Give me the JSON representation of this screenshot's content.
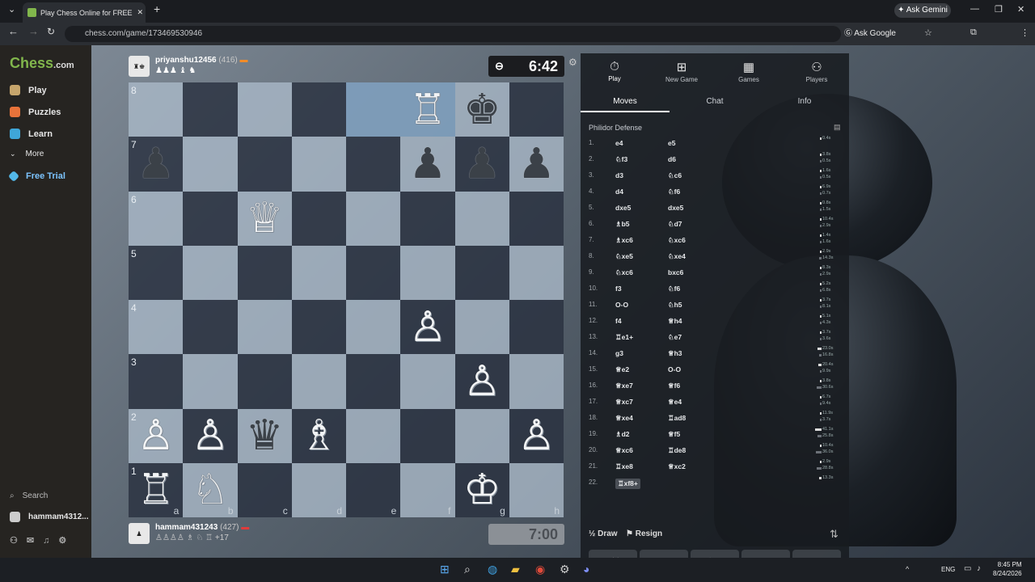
{
  "browser": {
    "tab_title": "Play Chess Online for FREE",
    "url": "chess.com/game/173469530946",
    "ask_google": "Ask Google",
    "ask_gemini": "Ask Gemini"
  },
  "sidebar": {
    "logo_main": "Chess",
    "logo_suffix": ".com",
    "items": [
      {
        "label": "Play",
        "icon": "pawn-icon"
      },
      {
        "label": "Puzzles",
        "icon": "puzzle-icon"
      },
      {
        "label": "Learn",
        "icon": "graduation-cap-icon"
      },
      {
        "label": "More",
        "icon": "chevron-down-icon"
      },
      {
        "label": "Free Trial",
        "icon": "diamond-icon"
      }
    ],
    "search_label": "Search",
    "user_label": "hammam4312..."
  },
  "top_player": {
    "name": "priyanshu12456",
    "rating": "(416)",
    "captured": "♟♟♟ ♝ ♞",
    "clock": "6:42"
  },
  "bottom_player": {
    "name": "hammam431243",
    "rating": "(427)",
    "captured": "♙♙♙♙ ♗ ♘ ♖",
    "advantage": "+17",
    "clock": "7:00"
  },
  "board": {
    "ranks": [
      "8",
      "7",
      "6",
      "5",
      "4",
      "3",
      "2",
      "1"
    ],
    "files": [
      "a",
      "b",
      "c",
      "d",
      "e",
      "f",
      "g",
      "h"
    ],
    "squares": [
      [
        "",
        "",
        "",
        "",
        "",
        "♖",
        "♚",
        ""
      ],
      [
        "♟",
        "",
        "",
        "",
        "",
        "♟",
        "♟",
        "♟"
      ],
      [
        "",
        "",
        "♕",
        "",
        "",
        "",
        "",
        ""
      ],
      [
        "",
        "",
        "",
        "",
        "",
        "",
        "",
        ""
      ],
      [
        "",
        "",
        "",
        "",
        "",
        "♙",
        "",
        ""
      ],
      [
        "",
        "",
        "",
        "",
        "",
        "",
        "♙",
        ""
      ],
      [
        "♙",
        "♙",
        "♛",
        "♗",
        "",
        "",
        "",
        "♙"
      ],
      [
        "♖",
        "♘",
        "",
        "",
        "",
        "",
        "♔",
        ""
      ]
    ],
    "colors": [
      "",
      "",
      "",
      "",
      "",
      "w",
      "b",
      "",
      "b",
      "",
      "",
      "",
      "",
      "b",
      "b",
      "b",
      "",
      "",
      "w",
      "",
      "",
      "",
      "",
      "",
      "",
      "",
      "",
      "",
      "",
      "",
      "",
      "",
      "",
      "",
      "",
      "",
      "",
      "w",
      "",
      "",
      "",
      "",
      "",
      "",
      "",
      "",
      "w",
      "",
      "w",
      "w",
      "b",
      "w",
      "",
      "",
      "",
      "w",
      "w",
      "w",
      "",
      "",
      "",
      "",
      "w",
      ""
    ],
    "highlight": [
      "e8",
      "f8"
    ]
  },
  "panel": {
    "tabs": [
      {
        "label": "Play",
        "icon": "stopwatch-icon"
      },
      {
        "label": "New Game",
        "icon": "plus-icon"
      },
      {
        "label": "Games",
        "icon": "grid-icon"
      },
      {
        "label": "Players",
        "icon": "players-icon"
      }
    ],
    "subtabs": [
      "Moves",
      "Chat",
      "Info"
    ],
    "opening": "Philidor Defense",
    "moves": [
      {
        "n": "1.",
        "w": "e4",
        "b": "e5",
        "tw": "0.4s",
        "tb": ""
      },
      {
        "n": "2.",
        "w": "♘f3",
        "b": "d6",
        "tw": "3.8s",
        "tb": "0.5s"
      },
      {
        "n": "3.",
        "w": "d3",
        "b": "♘c6",
        "tw": "1.6s",
        "tb": "0.5s"
      },
      {
        "n": "4.",
        "w": "d4",
        "b": "♘f6",
        "tw": "6.9s",
        "tb": "0.7s"
      },
      {
        "n": "5.",
        "w": "dxe5",
        "b": "dxe5",
        "tw": "0.8s",
        "tb": "1.5s"
      },
      {
        "n": "6.",
        "w": "♗b5",
        "b": "♘d7",
        "tw": "10.4s",
        "tb": "2.9s"
      },
      {
        "n": "7.",
        "w": "♗xc6",
        "b": "♘xc6",
        "tw": "1.4s",
        "tb": "1.6s"
      },
      {
        "n": "8.",
        "w": "♘xe5",
        "b": "♘xe4",
        "tw": "2.9s",
        "tb": "14.3s"
      },
      {
        "n": "9.",
        "w": "♘xc6",
        "b": "bxc6",
        "tw": "8.3s",
        "tb": "2.9s"
      },
      {
        "n": "10.",
        "w": "f3",
        "b": "♘f6",
        "tw": "5.2s",
        "tb": "6.8s"
      },
      {
        "n": "11.",
        "w": "O-O",
        "b": "♘h5",
        "tw": "3.7s",
        "tb": "8.1s"
      },
      {
        "n": "12.",
        "w": "f4",
        "b": "♕h4",
        "tw": "5.1s",
        "tb": "4.3s"
      },
      {
        "n": "13.",
        "w": "♖e1+",
        "b": "♘e7",
        "tw": "3.7s",
        "tb": "3.6s"
      },
      {
        "n": "14.",
        "w": "g3",
        "b": "♕h3",
        "tw": "23.0s",
        "tb": "16.8s"
      },
      {
        "n": "15.",
        "w": "♕e2",
        "b": "O-O",
        "tw": "20.4s",
        "tb": "9.9s"
      },
      {
        "n": "16.",
        "w": "♕xe7",
        "b": "♕f6",
        "tw": "3.8s",
        "tb": "30.6s"
      },
      {
        "n": "17.",
        "w": "♕xc7",
        "b": "♕e4",
        "tw": "6.7s",
        "tb": "9.4s"
      },
      {
        "n": "18.",
        "w": "♕xe4",
        "b": "♖ad8",
        "tw": "11.9s",
        "tb": "3.7s"
      },
      {
        "n": "19.",
        "w": "♗d2",
        "b": "♕f5",
        "tw": "41.1s",
        "tb": "25.8s"
      },
      {
        "n": "20.",
        "w": "♕xc6",
        "b": "♖de8",
        "tw": "10.4s",
        "tb": "36.0s"
      },
      {
        "n": "21.",
        "w": "♖xe8",
        "b": "♕xc2",
        "tw": "2.9s",
        "tb": "28.8s"
      },
      {
        "n": "22.",
        "w": "♖xf8+",
        "b": "",
        "tw": "13.3s",
        "tb": ""
      }
    ],
    "draw_label": "Draw",
    "draw_icon": "½",
    "resign_label": "Resign"
  },
  "taskbar": {
    "lang": "ENG",
    "time": "8:45 PM",
    "date": "8/24/2026"
  }
}
